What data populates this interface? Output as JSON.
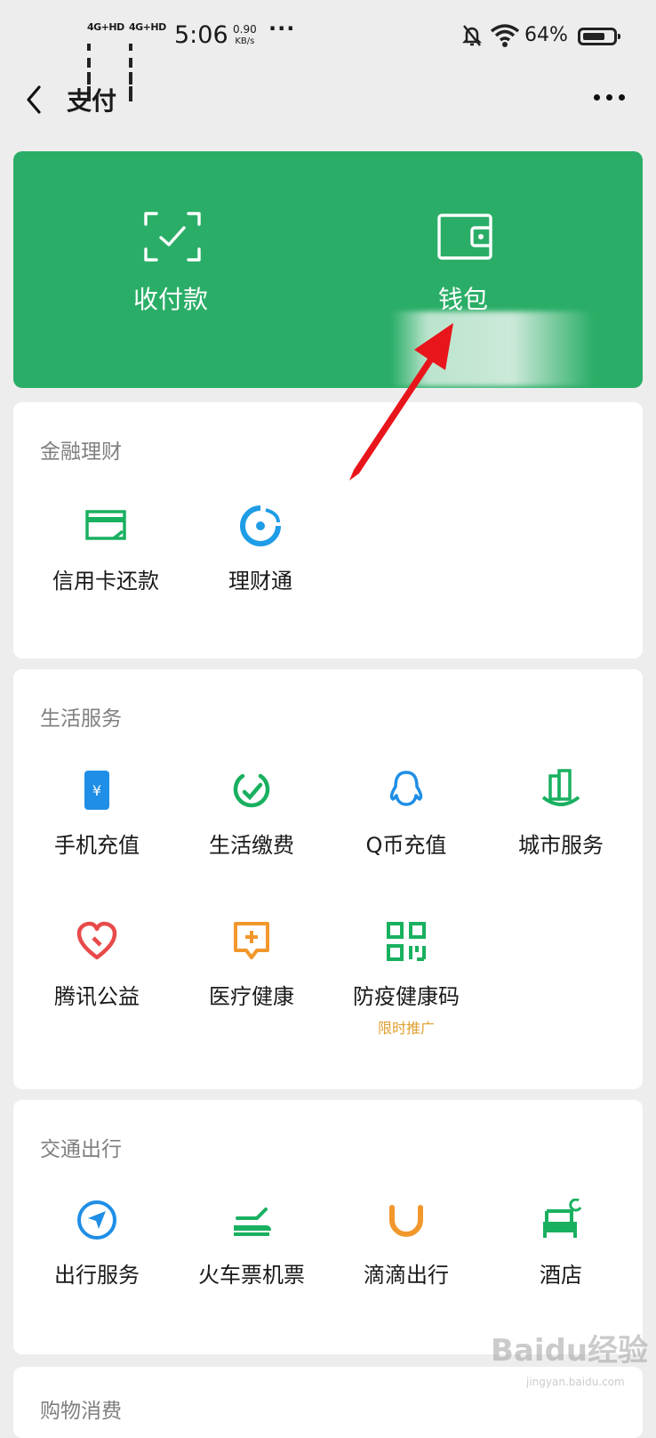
{
  "status_bar": {
    "network1": "4G+HD",
    "network2": "4G+HD",
    "time": "5:06",
    "speed_value": "0.90",
    "speed_unit": "KB/s",
    "more": "···",
    "battery_percent": "64%",
    "battery_level": 0.64
  },
  "nav": {
    "title": "支付"
  },
  "top_card": {
    "color": "#2aae67",
    "items": [
      {
        "label": "收付款",
        "icon": "scan-check-icon"
      },
      {
        "label": "钱包",
        "icon": "wallet-icon"
      }
    ]
  },
  "sections": {
    "finance": {
      "title": "金融理财",
      "items": [
        {
          "label": "信用卡还款",
          "icon": "credit-card-icon"
        },
        {
          "label": "理财通",
          "icon": "licaitong-icon"
        }
      ]
    },
    "life": {
      "title": "生活服务",
      "items": [
        {
          "label": "手机充值",
          "icon": "phone-topup-icon"
        },
        {
          "label": "生活缴费",
          "icon": "utility-payment-icon"
        },
        {
          "label": "Q币充值",
          "icon": "qq-coin-icon"
        },
        {
          "label": "城市服务",
          "icon": "city-service-icon"
        },
        {
          "label": "腾讯公益",
          "icon": "charity-heart-icon"
        },
        {
          "label": "医疗健康",
          "icon": "medical-icon"
        },
        {
          "label": "防疫健康码",
          "icon": "qr-code-icon",
          "sub": "限时推广"
        }
      ]
    },
    "transport": {
      "title": "交通出行",
      "items": [
        {
          "label": "出行服务",
          "icon": "navigation-icon"
        },
        {
          "label": "火车票机票",
          "icon": "train-plane-icon"
        },
        {
          "label": "滴滴出行",
          "icon": "didi-icon"
        },
        {
          "label": "酒店",
          "icon": "hotel-bed-icon"
        }
      ]
    },
    "shopping": {
      "title": "购物消费"
    }
  },
  "watermark": {
    "main": "Baidu经验",
    "url": "jingyan.baidu.com"
  }
}
